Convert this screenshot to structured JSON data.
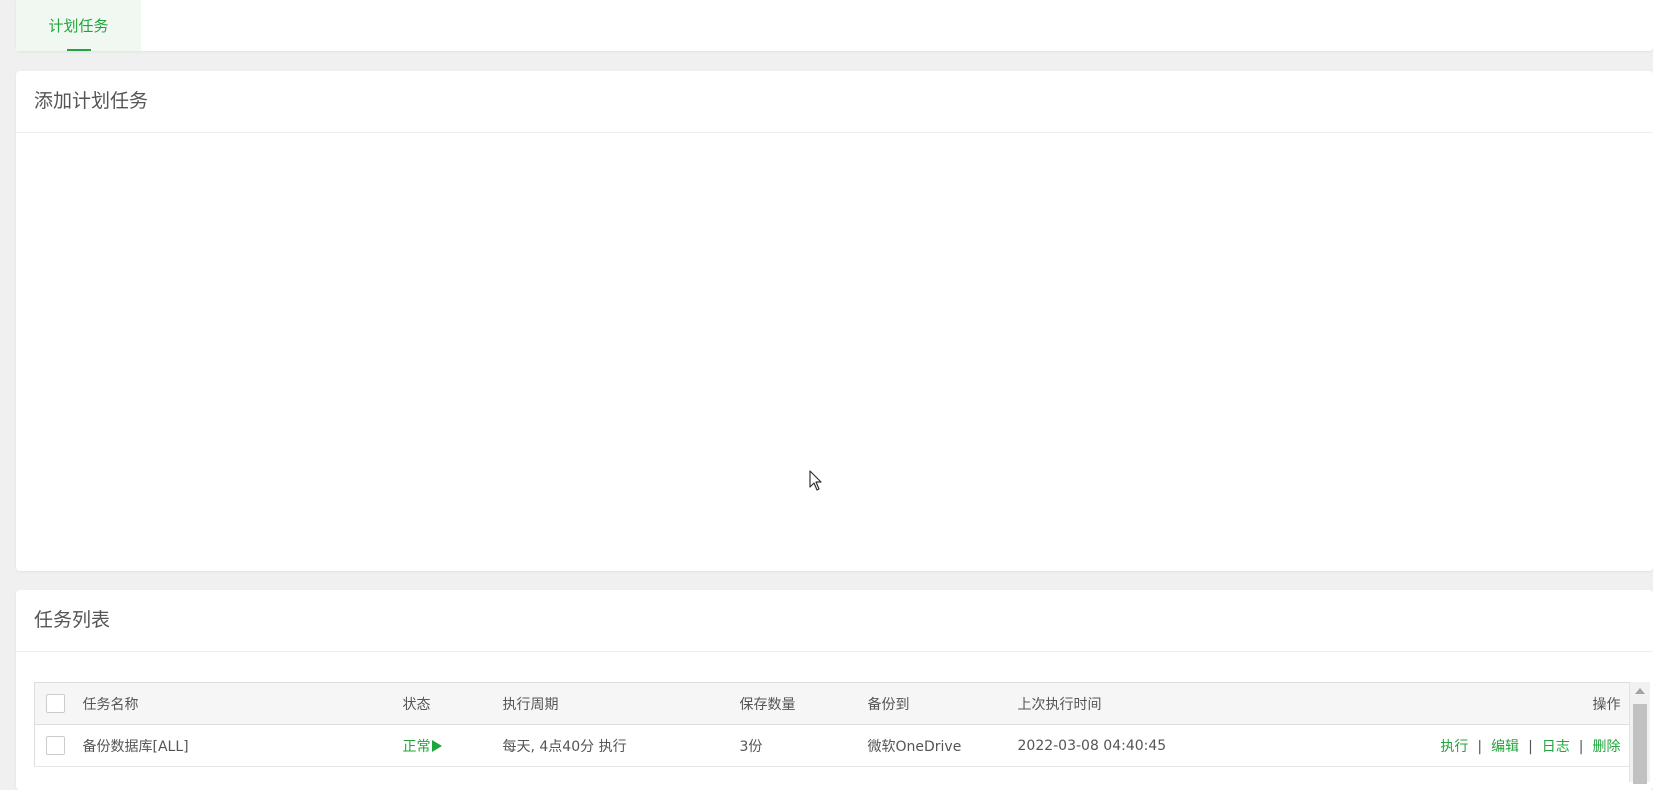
{
  "tabs": [
    {
      "label": "计划任务"
    }
  ],
  "add_section": {
    "title": "添加计划任务"
  },
  "list_section": {
    "title": "任务列表"
  },
  "table": {
    "headers": {
      "name": "任务名称",
      "status": "状态",
      "period": "执行周期",
      "keep": "保存数量",
      "backup_to": "备份到",
      "last_run": "上次执行时间",
      "actions": "操作"
    },
    "rows": [
      {
        "name": "备份数据库[ALL]",
        "status": "正常",
        "status_icon": "play-icon",
        "period": "每天, 4点40分 执行",
        "keep": "3份",
        "backup_to": "微软OneDrive",
        "last_run": "2022-03-08 04:40:45",
        "actions": [
          "执行",
          "编辑",
          "日志",
          "删除"
        ]
      }
    ],
    "action_separator": "|"
  },
  "colors": {
    "accent": "#20a53a",
    "background": "#f0f0f0"
  }
}
